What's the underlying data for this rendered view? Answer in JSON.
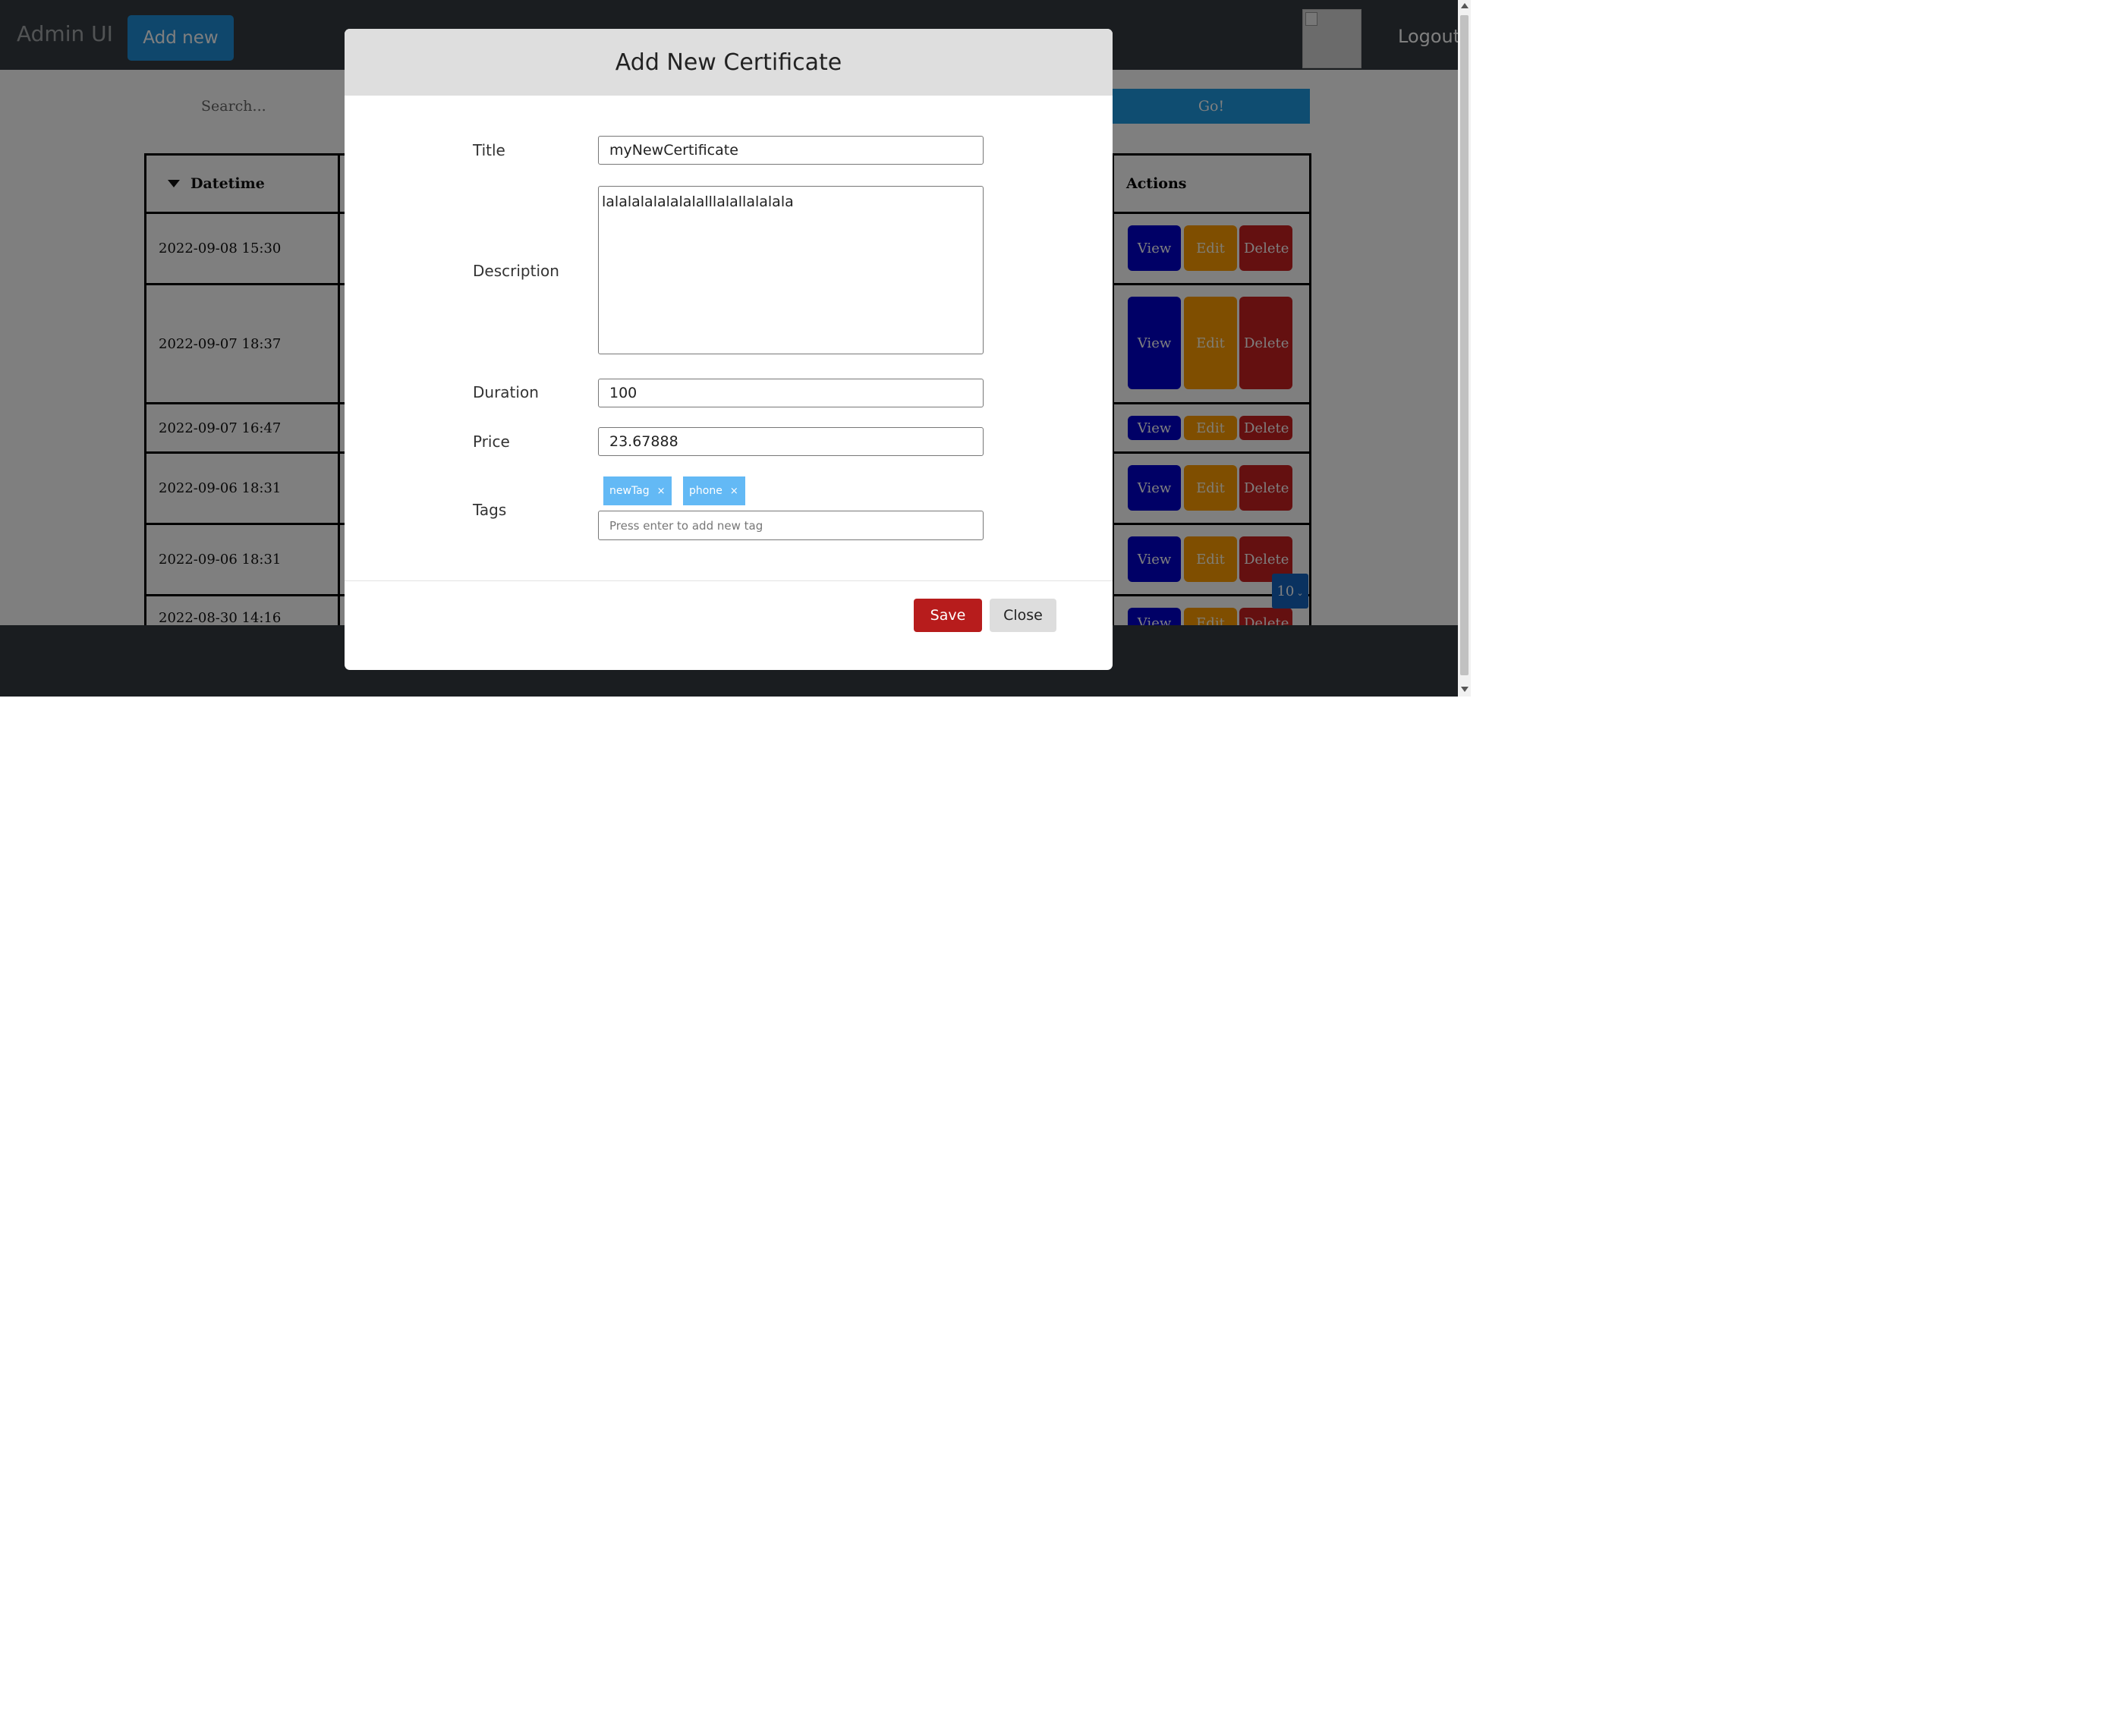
{
  "navbar": {
    "brand": "Admin UI",
    "add_new_label": "Add new",
    "logout_label": "Logout"
  },
  "search": {
    "placeholder": "Search...",
    "go_label": "Go!"
  },
  "table": {
    "header": {
      "datetime": "Datetime",
      "actions": "Actions"
    },
    "rows": [
      {
        "datetime": "2022-09-08 15:30"
      },
      {
        "datetime": "2022-09-07 18:37"
      },
      {
        "datetime": "2022-09-07 16:47"
      },
      {
        "datetime": "2022-09-06 18:31"
      },
      {
        "datetime": "2022-09-06 18:31"
      },
      {
        "datetime": "2022-08-30 14:16"
      }
    ],
    "action_labels": {
      "view": "View",
      "edit": "Edit",
      "delete": "Delete"
    }
  },
  "pagination": {
    "page_size": "10"
  },
  "modal": {
    "title": "Add New Certificate",
    "fields": {
      "title_label": "Title",
      "title_value": "myNewCertificate",
      "description_label": "Description",
      "description_value": "lalalalalalalalalllalallalalala",
      "duration_label": "Duration",
      "duration_value": "100",
      "price_label": "Price",
      "price_value": "23.67888",
      "tags_label": "Tags",
      "tags": [
        "newTag",
        "phone"
      ],
      "tag_remove_glyph": "×",
      "tag_input_placeholder": "Press enter to add new tag"
    },
    "save_label": "Save",
    "close_label": "Close"
  },
  "colors": {
    "navbar_bg": "#343a40",
    "primary": "#1f8fd8",
    "view_button": "#0000cc",
    "edit_button": "#ff9d00",
    "delete_button": "#c82020",
    "save_button": "#b71c1c",
    "tag_chip": "#63b9f5"
  }
}
